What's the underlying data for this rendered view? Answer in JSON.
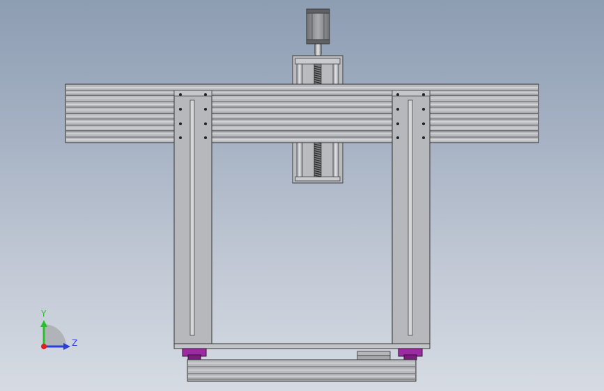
{
  "view": {
    "background_top": "#8d9db2",
    "background_bottom": "#d6dbe3",
    "part_fill": "#b5b7bb",
    "part_edge": "#3a3a3a",
    "carriage_color": "#9c2aa0"
  },
  "triad": {
    "y_label": "Y",
    "z_label": "Z",
    "y_color": "#2bbf2b",
    "z_color": "#2a3fd6",
    "x_color": "#e02020"
  }
}
